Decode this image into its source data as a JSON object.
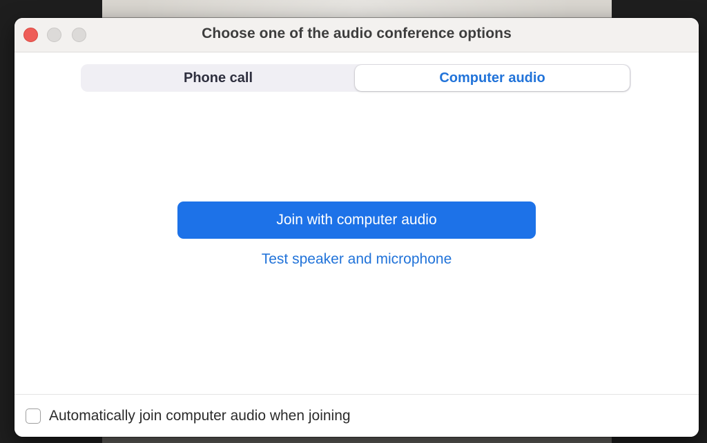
{
  "window": {
    "title": "Choose one of the audio conference options"
  },
  "tabs": [
    {
      "label": "Phone call",
      "selected": false
    },
    {
      "label": "Computer audio",
      "selected": true
    }
  ],
  "main": {
    "join_button_label": "Join with computer audio",
    "test_link_label": "Test speaker and microphone"
  },
  "footer": {
    "auto_join_label": "Automatically join computer audio when joining",
    "auto_join_checked": false
  },
  "colors": {
    "accent": "#1d72e8",
    "link": "#2173d9",
    "close_button": "#ee5d58"
  },
  "icons": [
    "close-icon",
    "minimize-icon",
    "zoom-icon",
    "checkbox-icon"
  ]
}
